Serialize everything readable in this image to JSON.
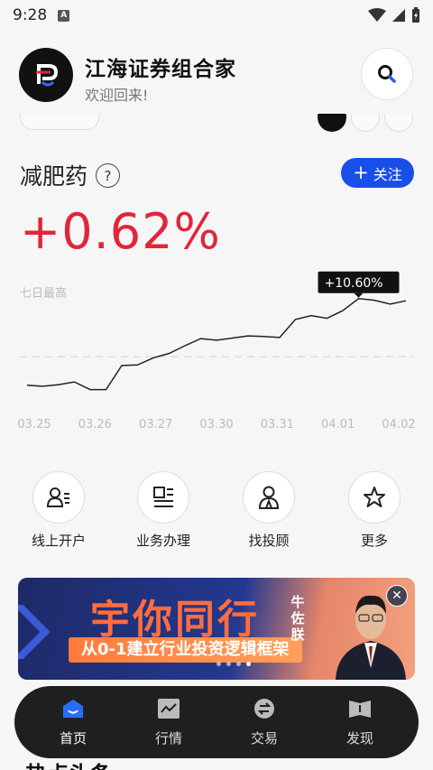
{
  "status": {
    "time": "9:28"
  },
  "header": {
    "app_title": "江海证券组合家",
    "welcome": "欢迎回来!"
  },
  "portfolio": {
    "name": "减肥药",
    "help": "?",
    "follow_label": "关注",
    "return_value": "+0.62%",
    "chart_caption": "七日最高"
  },
  "chart_data": {
    "type": "line",
    "series": [
      {
        "values": [
          -5.2,
          -5.4,
          -5.1,
          -4.6,
          -6.0,
          -6.0,
          -1.6,
          -1.5,
          -0.2,
          0.6,
          2.0,
          3.3,
          3.0,
          3.4,
          3.8,
          3.7,
          3.5,
          6.8,
          7.5,
          7.0,
          8.4,
          10.6,
          10.3,
          9.6,
          10.2
        ]
      }
    ],
    "x_ticks": [
      "03.25",
      "03.26",
      "03.27",
      "03.30",
      "03.31",
      "04.01",
      "04.02"
    ],
    "max_label": "+10.60%",
    "reference_value": 0,
    "ylim": [
      -12,
      16
    ]
  },
  "quick_actions": [
    {
      "label": "线上开户",
      "icon": "person-card-icon"
    },
    {
      "label": "业务办理",
      "icon": "document-icon"
    },
    {
      "label": "找投顾",
      "icon": "advisor-icon"
    },
    {
      "label": "更多",
      "icon": "star-icon"
    }
  ],
  "banner": {
    "title": "宇你同行",
    "subtitle": "从0-1建立行业投资逻辑框架",
    "name": "牛佐朕",
    "close": "✕"
  },
  "nav": [
    {
      "label": "首页",
      "icon": "home-icon",
      "active": true
    },
    {
      "label": "行情",
      "icon": "market-icon",
      "active": false
    },
    {
      "label": "交易",
      "icon": "trade-icon",
      "active": false
    },
    {
      "label": "发现",
      "icon": "discover-icon",
      "active": false
    }
  ],
  "news": {
    "heading": "热点头条"
  }
}
